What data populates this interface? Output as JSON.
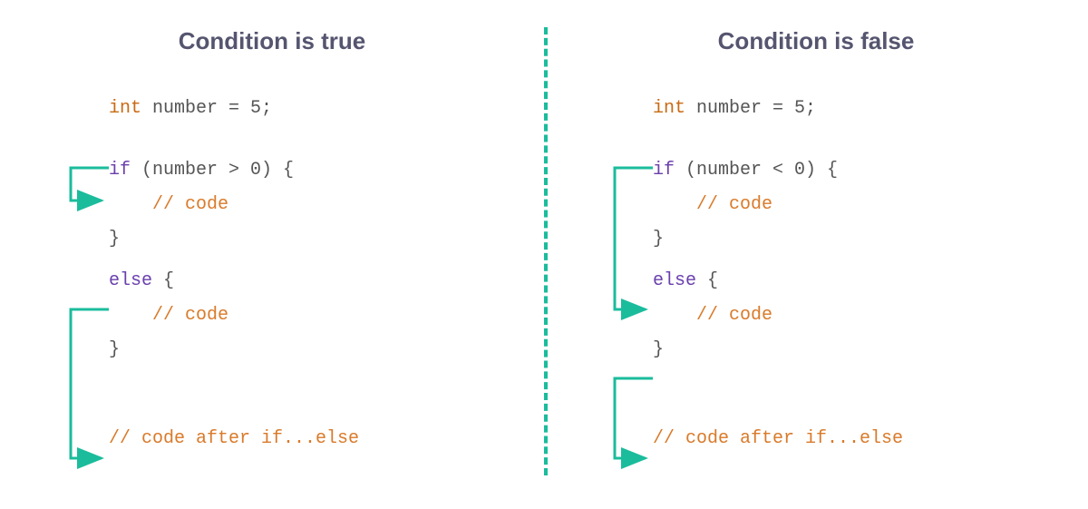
{
  "left": {
    "title": "Condition is true",
    "declaration": {
      "kw": "int",
      "rest": " number = 5;"
    },
    "if_line": {
      "kw": "if",
      "cond": " (number > 0) {"
    },
    "if_body": "// code",
    "close1": "}",
    "else_line": {
      "kw": "else",
      "rest": " {"
    },
    "else_body": "// code",
    "close2": "}",
    "after": "// code after if...else"
  },
  "right": {
    "title": "Condition is false",
    "declaration": {
      "kw": "int",
      "rest": " number = 5;"
    },
    "if_line": {
      "kw": "if",
      "cond": " (number < 0) {"
    },
    "if_body": "// code",
    "close1": "}",
    "else_line": {
      "kw": "else",
      "rest": " {"
    },
    "else_body": "// code",
    "close2": "}",
    "after": "// code after if...else"
  },
  "colors": {
    "accent": "#1abc9c",
    "title": "#555570",
    "keyword_type": "#c96a12",
    "keyword_flow": "#6a3fad",
    "comment": "#d97a2a",
    "text": "#555"
  }
}
